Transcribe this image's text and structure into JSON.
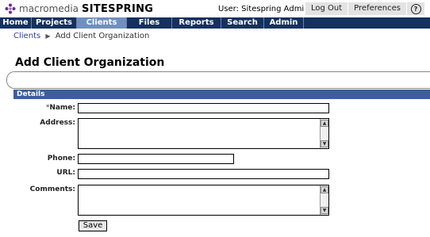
{
  "header": {
    "logo_prefix": "macromedia",
    "logo_brand": "SITESPRING",
    "user_label": "User: Sitespring Administrator",
    "links": [
      "Log Out",
      "Preferences"
    ],
    "help_label": "?"
  },
  "nav": {
    "tabs": [
      "Home",
      "Projects",
      "Clients",
      "Files",
      "Reports",
      "Search",
      "Admin"
    ],
    "active": "Clients"
  },
  "breadcrumb": {
    "link": "Clients",
    "current": "Add Client Organization"
  },
  "page": {
    "title": "Add Client Organization"
  },
  "section": {
    "title": "Details"
  },
  "form": {
    "required_marker": "*",
    "name_label": "Name:",
    "address_label": "Address:",
    "phone_label": "Phone:",
    "url_label": "URL:",
    "comments_label": "Comments:",
    "name_value": "",
    "address_value": "",
    "phone_value": "",
    "url_value": "",
    "comments_value": "",
    "save_label": "Save"
  },
  "colors": {
    "nav_bg": "#14315f",
    "nav_active": "#6f8fc0",
    "section_bg": "#3d5e9a"
  }
}
